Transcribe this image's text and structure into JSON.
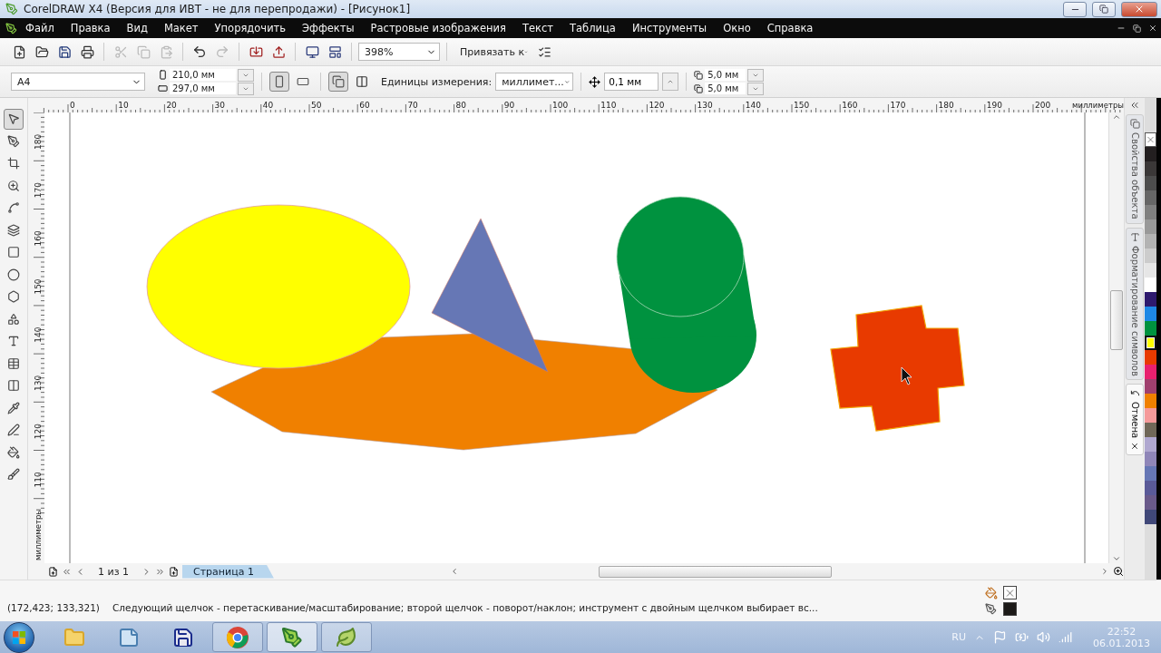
{
  "window": {
    "title": "CorelDRAW X4 (Версия для ИВТ - не для перепродажи) - [Рисунок1]"
  },
  "menu": [
    {
      "label": "Файл"
    },
    {
      "label": "Правка"
    },
    {
      "label": "Вид"
    },
    {
      "label": "Макет"
    },
    {
      "label": "Упорядочить"
    },
    {
      "label": "Эффекты"
    },
    {
      "label": "Растровые изображения"
    },
    {
      "label": "Текст"
    },
    {
      "label": "Таблица"
    },
    {
      "label": "Инструменты"
    },
    {
      "label": "Окно"
    },
    {
      "label": "Справка"
    }
  ],
  "toolbar": {
    "zoom": "398%",
    "snap": "Привязать к"
  },
  "property_bar": {
    "page_size": "A4",
    "width": "210,0 мм",
    "height": "297,0 мм",
    "orientation": [
      {
        "selected": true
      },
      {
        "selected": false
      }
    ],
    "units_label": "Единицы измерения:",
    "units": "миллимет...",
    "nudge": "0,1 мм",
    "dup_x": "5,0 мм",
    "dup_y": "5,0 мм"
  },
  "toolbox": [
    {
      "selected": true
    },
    {
      "selected": false
    },
    {
      "selected": false
    },
    {
      "selected": false
    },
    {
      "selected": false
    },
    {
      "selected": false
    },
    {
      "selected": false
    },
    {
      "selected": false
    },
    {
      "selected": false
    },
    {
      "selected": false
    },
    {
      "selected": false
    },
    {
      "selected": false
    },
    {
      "selected": false
    },
    {
      "selected": false
    },
    {
      "selected": false
    },
    {
      "selected": false
    },
    {
      "selected": false
    }
  ],
  "ruler": {
    "h_ticks": [
      "0",
      "10",
      "20",
      "30",
      "40",
      "50",
      "60",
      "70",
      "80",
      "90",
      "100",
      "110",
      "120",
      "130",
      "140",
      "150",
      "160",
      "170",
      "180",
      "190",
      "200"
    ],
    "h_unit": "миллиметры",
    "v_ticks": [
      "180",
      "170",
      "160",
      "150",
      "140",
      "130",
      "120",
      "110"
    ],
    "v_unit": "миллиметры"
  },
  "canvas": {
    "shapes": [
      {
        "kind": "polygon",
        "color": "#f08000"
      },
      {
        "kind": "ellipse",
        "color": "#ffff00"
      },
      {
        "kind": "triangle",
        "color": "#6677b5"
      },
      {
        "kind": "cylinder",
        "color": "#00923f"
      },
      {
        "kind": "cross",
        "color": "#e83a00"
      }
    ]
  },
  "dockers": [
    {
      "label": "Свойства объекта",
      "selected": false
    },
    {
      "label": "Форматирование символов",
      "selected": false
    },
    {
      "label": "Отмена",
      "selected": true
    }
  ],
  "palette": [
    {
      "kind": "none",
      "selected": false
    },
    {
      "color": "#231f20",
      "selected": false
    },
    {
      "color": "#3b3838",
      "selected": false
    },
    {
      "color": "#4d4d4d",
      "selected": false
    },
    {
      "color": "#666666",
      "selected": false
    },
    {
      "color": "#808080",
      "selected": false
    },
    {
      "color": "#999999",
      "selected": false
    },
    {
      "color": "#b3b3b3",
      "selected": false
    },
    {
      "color": "#cccccc",
      "selected": false
    },
    {
      "color": "#e6e6e6",
      "selected": false
    },
    {
      "color": "#ffffff",
      "selected": false
    },
    {
      "color": "#2e1a6e",
      "selected": false
    },
    {
      "color": "#1e88e5",
      "selected": false
    },
    {
      "color": "#00923f",
      "selected": false
    },
    {
      "color": "#ffff00",
      "selected": true
    },
    {
      "color": "#e83a00",
      "selected": false
    },
    {
      "color": "#e8206e",
      "selected": false
    },
    {
      "color": "#a0406e",
      "selected": false
    },
    {
      "color": "#f08000",
      "selected": false
    },
    {
      "color": "#f59a9a",
      "selected": false
    },
    {
      "color": "#706858",
      "selected": false
    },
    {
      "color": "#b0a8d0",
      "selected": false
    },
    {
      "color": "#8f86b8",
      "selected": false
    },
    {
      "color": "#6677b5",
      "selected": false
    },
    {
      "color": "#5a5a98",
      "selected": false
    },
    {
      "color": "#6a5a8a",
      "selected": false
    },
    {
      "color": "#404878",
      "selected": false
    }
  ],
  "page_nav": {
    "counter": "1 из 1",
    "tabs": [
      {
        "label": "Страница 1",
        "selected": true
      }
    ]
  },
  "status_bar": {
    "coords": "(172,423; 133,321)",
    "hint": "Следующий щелчок - перетаскивание/масштабирование; второй щелчок - поворот/наклон; инструмент с двойным щелчком выбирает вс...",
    "fill": {
      "kind": "none"
    },
    "outline": {
      "kind": "solid",
      "color": "#1c1a18"
    }
  },
  "taskbar": {
    "apps": [
      {
        "selected": false,
        "running": false
      },
      {
        "selected": false,
        "running": false
      },
      {
        "selected": false,
        "running": false
      },
      {
        "selected": false,
        "running": true
      },
      {
        "selected": true,
        "running": true
      },
      {
        "selected": false,
        "running": true
      }
    ],
    "language": "RU",
    "time": "22:52",
    "date": "06.01.2013"
  }
}
